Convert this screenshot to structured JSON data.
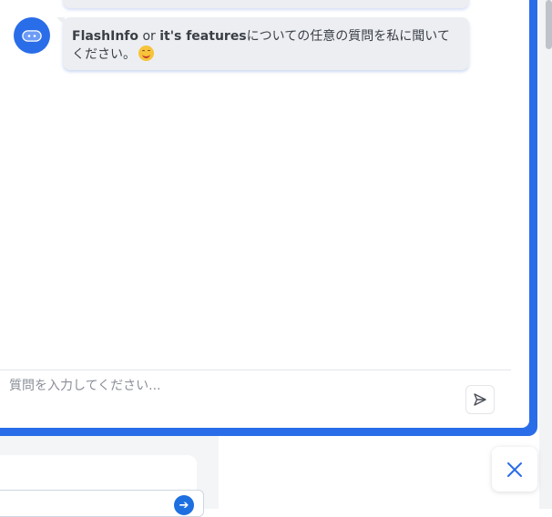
{
  "chat": {
    "bot_message": {
      "part1_bold": "FlashInfo",
      "part2": " or ",
      "part3_bold": "it's features",
      "part4": "についての任意の質問を私に聞いてください。"
    },
    "input_placeholder": "質問を入力してください..."
  },
  "background": {
    "send_icon": "arrow-right-circle-icon"
  },
  "icons": {
    "bot_avatar": "robot-icon",
    "send": "send-icon",
    "close": "close-icon",
    "emoji": "smiley-emoji-icon"
  },
  "colors": {
    "accent": "#2a6de8",
    "bubble_bg": "#eceef2",
    "text": "#3a3f46",
    "placeholder": "#8a8f98"
  }
}
